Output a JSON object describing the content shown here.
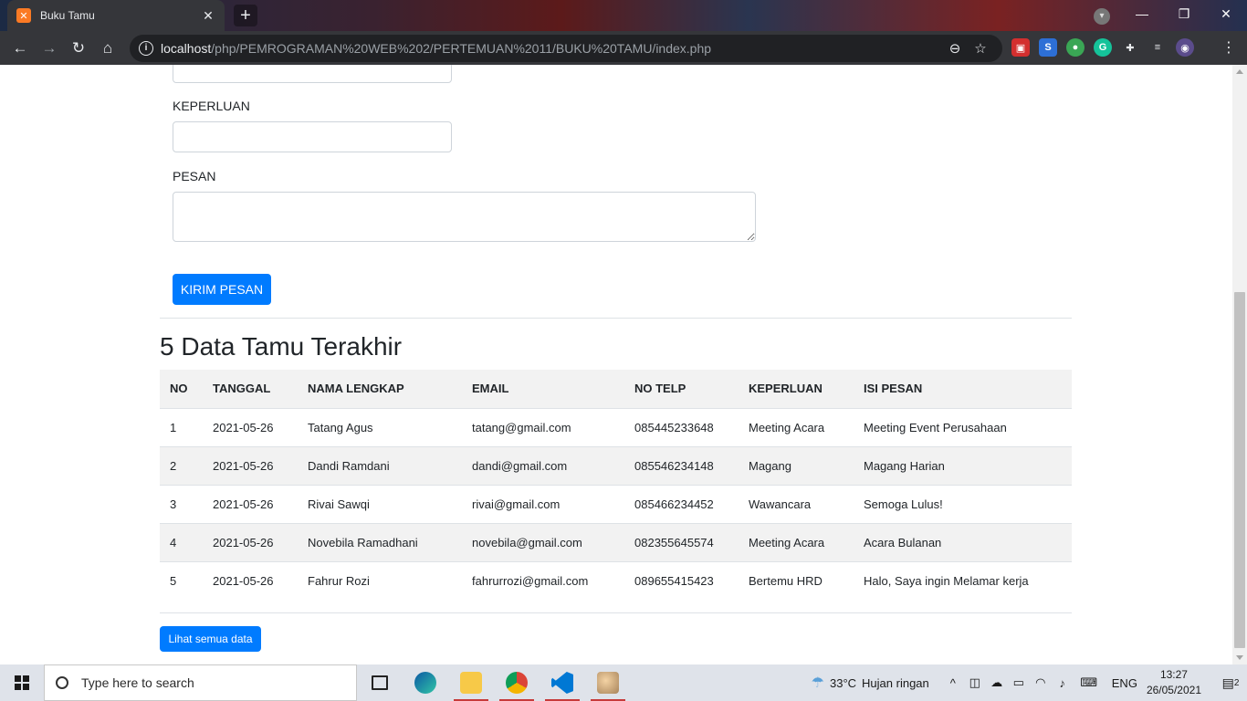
{
  "browser": {
    "tab_title": "Buku Tamu",
    "tab_favicon": "xampp-icon",
    "url_host": "localhost",
    "url_path": "/php/PEMROGRAMAN%20WEB%202/PERTEMUAN%2011/BUKU%20TAMU/index.php"
  },
  "form": {
    "label_keperluan": "KEPERLUAN",
    "label_pesan": "PESAN",
    "keperluan_value": "",
    "pesan_value": "",
    "submit_label": "KIRIM PESAN"
  },
  "section": {
    "title": "5 Data Tamu Terakhir",
    "view_all_label": "Lihat semua data"
  },
  "table": {
    "headers": [
      "NO",
      "TANGGAL",
      "NAMA LENGKAP",
      "EMAIL",
      "NO TELP",
      "KEPERLUAN",
      "ISI PESAN"
    ],
    "rows": [
      [
        "1",
        "2021-05-26",
        "Tatang Agus",
        "tatang@gmail.com",
        "085445233648",
        "Meeting Acara",
        "Meeting Event Perusahaan"
      ],
      [
        "2",
        "2021-05-26",
        "Dandi Ramdani",
        "dandi@gmail.com",
        "085546234148",
        "Magang",
        "Magang Harian"
      ],
      [
        "3",
        "2021-05-26",
        "Rivai Sawqi",
        "rivai@gmail.com",
        "085466234452",
        "Wawancara",
        "Semoga Lulus!"
      ],
      [
        "4",
        "2021-05-26",
        "Novebila Ramadhani",
        "novebila@gmail.com",
        "082355645574",
        "Meeting Acara",
        "Acara Bulanan"
      ],
      [
        "5",
        "2021-05-26",
        "Fahrur Rozi",
        "fahrurrozi@gmail.com",
        "089655415423",
        "Bertemu HRD",
        "Halo, Saya ingin Melamar kerja"
      ]
    ]
  },
  "taskbar": {
    "search_placeholder": "Type here to search",
    "weather_temp": "33°C",
    "weather_desc": "Hujan ringan",
    "lang": "ENG",
    "time": "13:27",
    "date": "26/05/2021",
    "notif_count": "2"
  },
  "colors": {
    "primary": "#007bff",
    "table_stripe": "#f2f2f2",
    "chrome_dark": "#35363a"
  }
}
